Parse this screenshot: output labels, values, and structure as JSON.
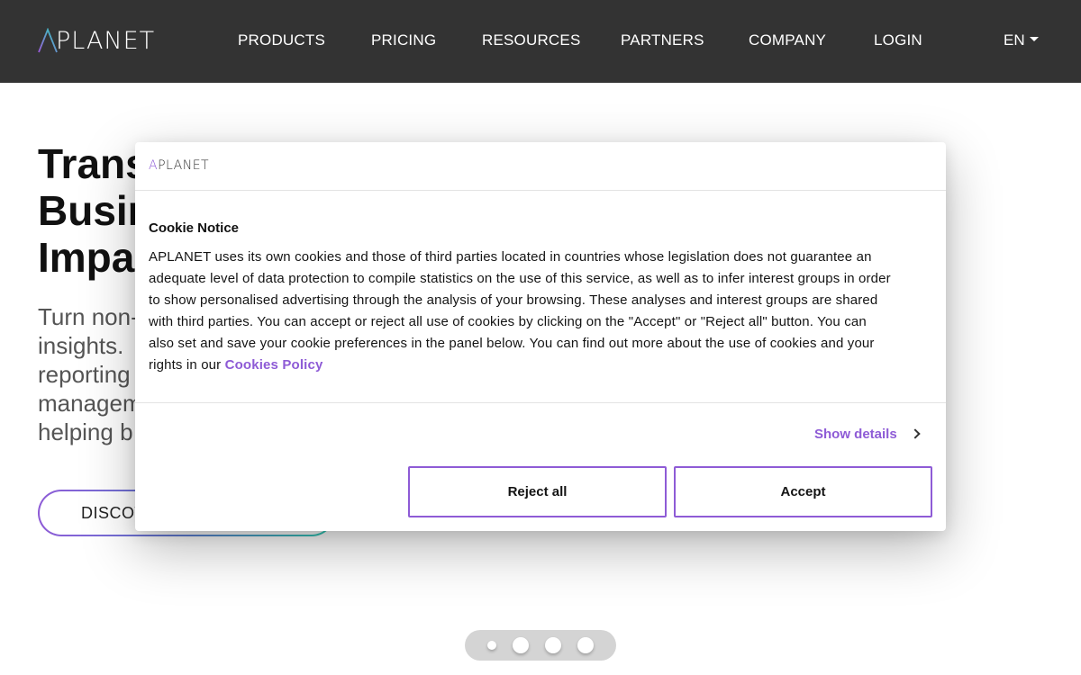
{
  "brand": {
    "logo_text": "APLANET",
    "logo_rest": "PLANET",
    "accent": "#8e5bd6",
    "accent_alt": "#2fcfb5",
    "nav_bg": "#333333"
  },
  "nav": {
    "items": [
      {
        "label": "PRODUCTS"
      },
      {
        "label": "PRICING"
      },
      {
        "label": "RESOURCES"
      },
      {
        "label": "PARTNERS"
      },
      {
        "label": "COMPANY"
      },
      {
        "label": "LOGIN"
      }
    ],
    "language": "EN"
  },
  "hero": {
    "title_lines": [
      "Trans",
      "Busin",
      "Impa"
    ],
    "subtitle_lines": [
      "Turn non-",
      "insights. ",
      "reporting",
      "managem",
      "helping b"
    ],
    "cta_label": "DISCOV"
  },
  "carousel": {
    "slides": 4,
    "active_index": 0
  },
  "cookie_dialog": {
    "logo_text": "APLANET",
    "title": "Cookie Notice",
    "body_lines": [
      "APLANET uses its own cookies and those of third parties located in countries whose legislation does not guarantee an",
      "adequate level of data protection to compile statistics on the use of this service, as well as to infer interest groups in order",
      "to show personalised advertising through the analysis of your browsing. These analyses and interest groups are shared",
      "with third parties. You can accept or reject all use of cookies by clicking on the \"Accept\" or \"Reject all\" button. You can",
      "also set and save your cookie preferences in the panel below. You can find out more about the use of cookies and your"
    ],
    "body_last_prefix": "rights in our ",
    "policy_link": "Cookies Policy",
    "show_details": "Show details",
    "reject_label": "Reject all",
    "accept_label": "Accept"
  }
}
